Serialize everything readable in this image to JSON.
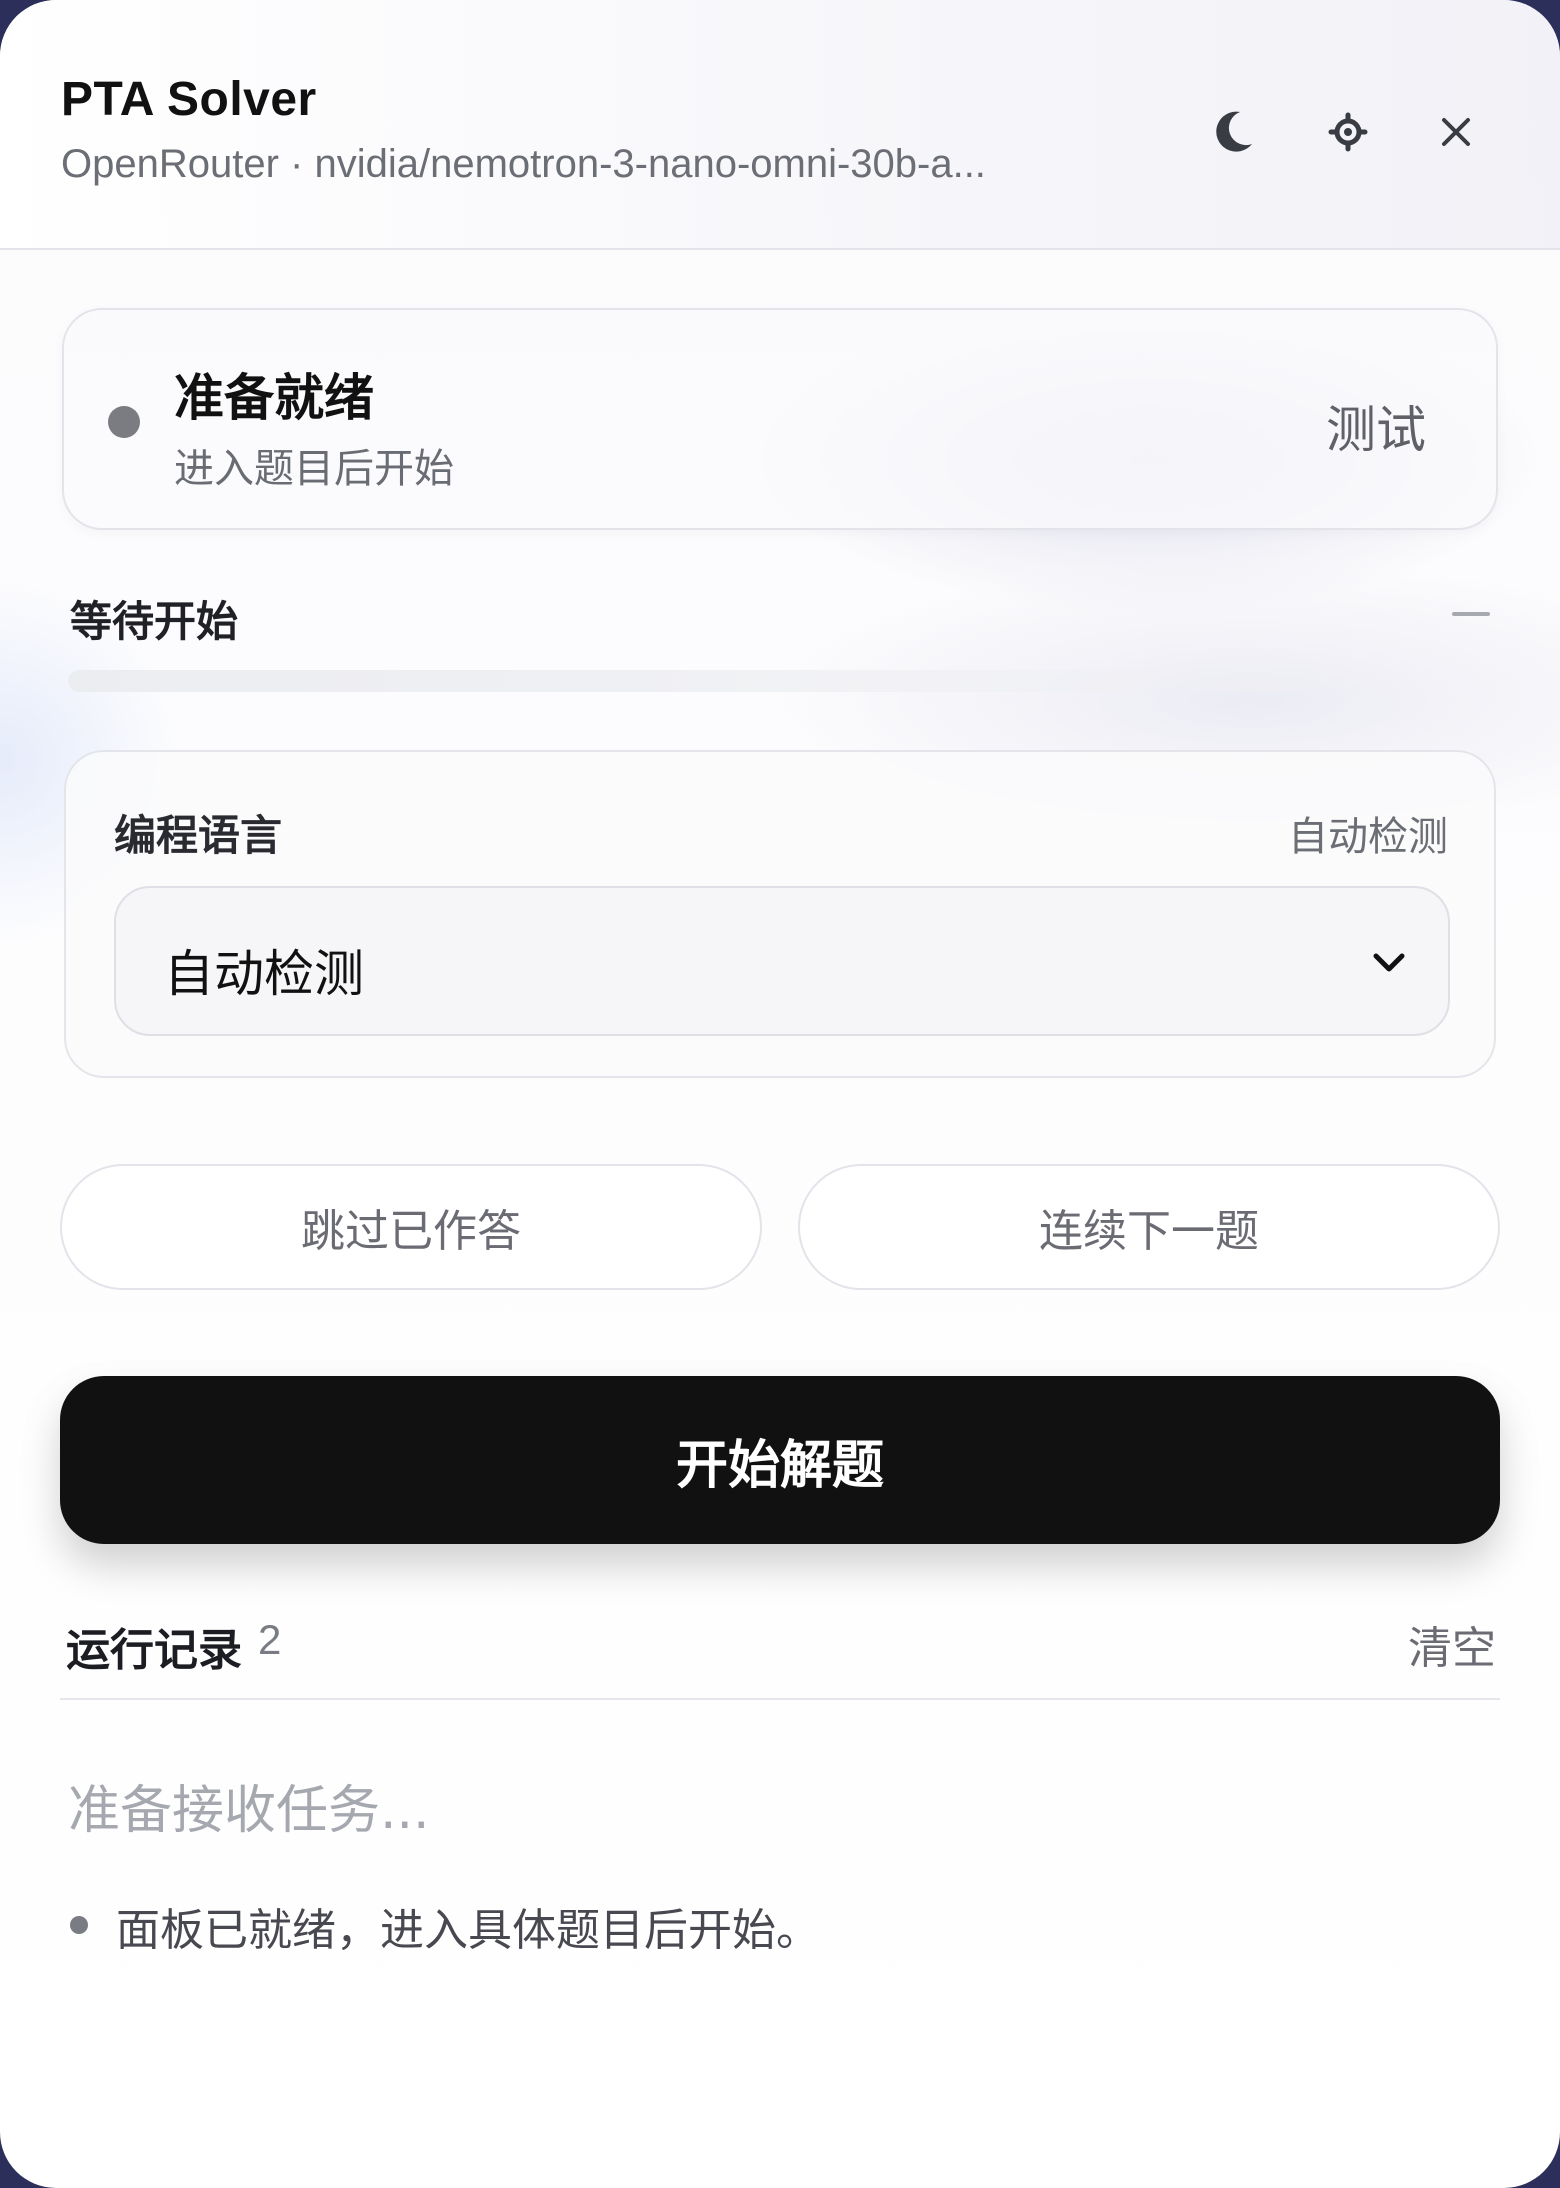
{
  "header": {
    "title": "PTA Solver",
    "subtitle": "OpenRouter · nvidia/nemotron-3-nano-omni-30b-a...",
    "icons": [
      "moon-icon",
      "gear-icon",
      "close-icon"
    ]
  },
  "status": {
    "title": "准备就绪",
    "subtitle": "进入题目后开始",
    "test_label": "测试"
  },
  "progress": {
    "label": "等待开始",
    "value": 0
  },
  "language": {
    "label": "编程语言",
    "detected": "自动检测",
    "selected": "自动检测"
  },
  "actions": {
    "skip_answered": "跳过已作答",
    "continue_next": "连续下一题",
    "start": "开始解题"
  },
  "log": {
    "title": "运行记录",
    "count": "2",
    "clear_label": "清空",
    "placeholder": "准备接收任务...",
    "entries": [
      {
        "text": "面板已就绪，进入具体题目后开始。"
      }
    ]
  },
  "colors": {
    "primary_button": "#111112",
    "status_dot": "#7b7c82"
  }
}
